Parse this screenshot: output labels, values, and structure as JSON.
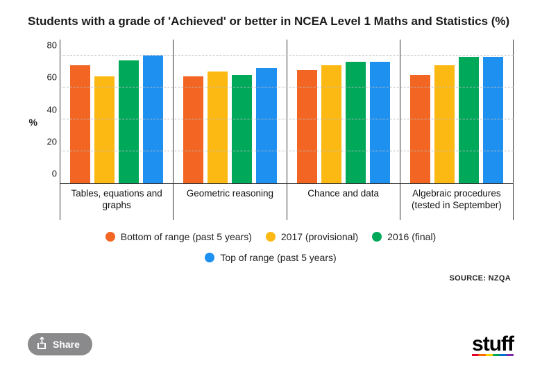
{
  "title": "Students with a grade of 'Achieved' or better in NCEA Level 1 Maths and Statistics (%)",
  "chart_data": {
    "type": "bar",
    "ylabel": "%",
    "ylim": [
      0,
      90
    ],
    "yticks": [
      0,
      20,
      40,
      60,
      80
    ],
    "categories": [
      "Tables, equations and graphs",
      "Geometric reasoning",
      "Chance and data",
      "Algebraic procedures (tested in September)"
    ],
    "series": [
      {
        "name": "Bottom of range (past 5 years)",
        "color": "#f26522",
        "values": [
          74,
          67,
          71,
          68
        ]
      },
      {
        "name": "2017 (provisional)",
        "color": "#fdb913",
        "values": [
          67,
          70,
          74,
          74
        ]
      },
      {
        "name": "2016 (final)",
        "color": "#00a85a",
        "values": [
          77,
          68,
          76,
          79
        ]
      },
      {
        "name": "Top of range (past 5 years)",
        "color": "#1e90f0",
        "values": [
          80,
          72,
          76,
          79
        ]
      }
    ]
  },
  "source_label": "SOURCE: NZQA",
  "share_label": "Share",
  "brand": "stuff"
}
